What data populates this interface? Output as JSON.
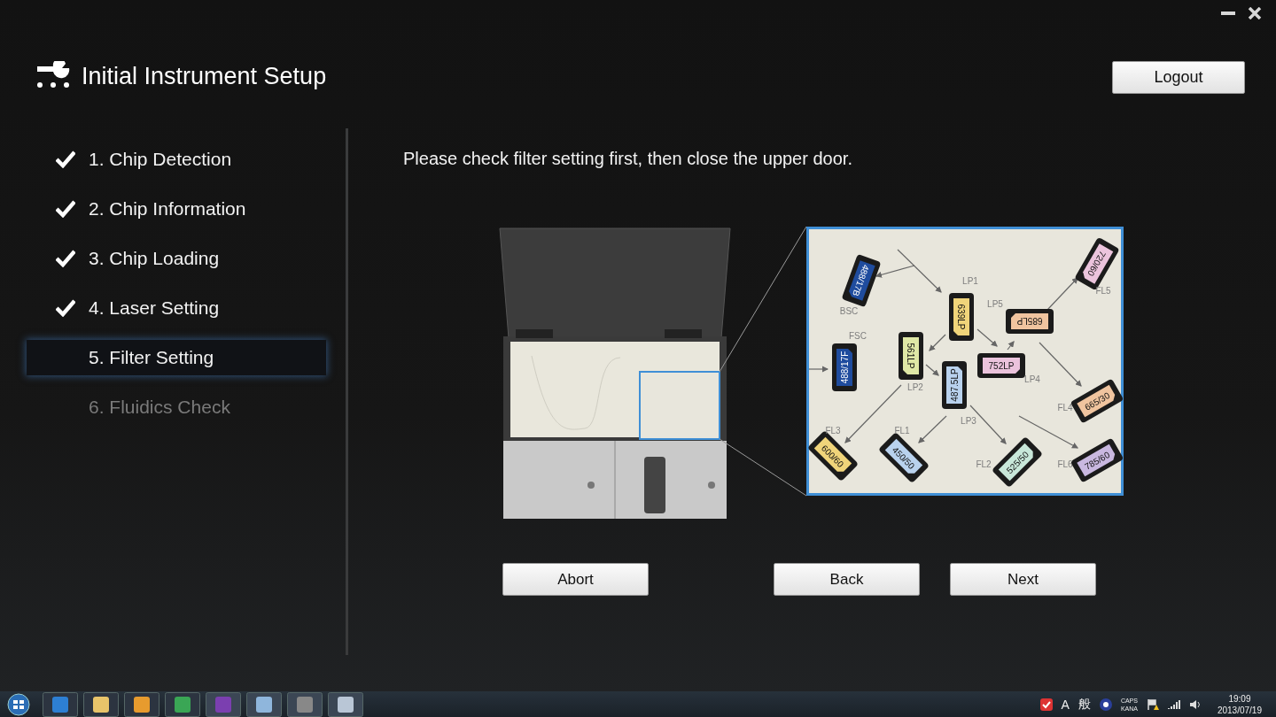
{
  "window": {
    "title": "Initial Instrument Setup"
  },
  "logout_button": {
    "label": "Logout"
  },
  "steps": [
    {
      "label": "1. Chip Detection",
      "done": true,
      "selected": false,
      "disabled": false
    },
    {
      "label": "2. Chip Information",
      "done": true,
      "selected": false,
      "disabled": false
    },
    {
      "label": "3. Chip Loading",
      "done": true,
      "selected": false,
      "disabled": false
    },
    {
      "label": "4. Laser Setting",
      "done": true,
      "selected": false,
      "disabled": false
    },
    {
      "label": "5. Filter Setting",
      "done": false,
      "selected": true,
      "disabled": false
    },
    {
      "label": "6. Fluidics Check",
      "done": false,
      "selected": false,
      "disabled": true
    }
  ],
  "instruction": "Please check filter setting first, then close the upper door.",
  "filter_diagram": {
    "filters": [
      {
        "label": "488/17B",
        "color": "#1f4c9e"
      },
      {
        "label": "488/17F",
        "color": "#1f4c9e"
      },
      {
        "label": "639LP",
        "color": "#f0d47a"
      },
      {
        "label": "561LP",
        "color": "#dfe8a6"
      },
      {
        "label": "487.5LP",
        "color": "#b9d2ee"
      },
      {
        "label": "752LP",
        "color": "#ebc3dc"
      },
      {
        "label": "685LP",
        "color": "#f0c49f"
      },
      {
        "label": "720/60",
        "color": "#ecc4dd"
      },
      {
        "label": "665/30",
        "color": "#f0c49f"
      },
      {
        "label": "785/60",
        "color": "#c9b8e0"
      },
      {
        "label": "525/50",
        "color": "#c8e7d9"
      },
      {
        "label": "450/50",
        "color": "#b9d2ee"
      },
      {
        "label": "600/60",
        "color": "#f0d47a"
      }
    ],
    "position_labels": [
      "BSC",
      "FSC",
      "LP1",
      "LP5",
      "LP2",
      "LP4",
      "LP3",
      "FL3",
      "FL1",
      "FL2",
      "FL6",
      "FL4",
      "FL5"
    ]
  },
  "buttons": [
    {
      "label": "Abort"
    },
    {
      "label": "Back"
    },
    {
      "label": "Next"
    }
  ],
  "taskbar": {
    "ime": [
      "A",
      "般"
    ],
    "indicators": [
      "CAPS",
      "KANA"
    ],
    "time": "19:09",
    "date": "2013/07/19"
  }
}
